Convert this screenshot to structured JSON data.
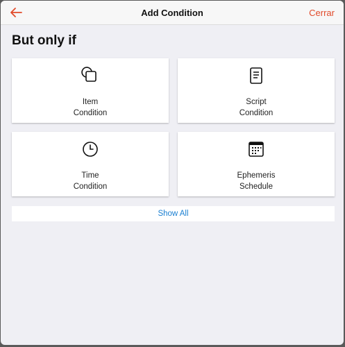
{
  "navbar": {
    "title": "Add Condition",
    "cancel_label": "Cerrar",
    "accent_color": "#e14a2a"
  },
  "section": {
    "title": "But only if"
  },
  "cards": [
    {
      "icon": "overlapping-squares-icon",
      "line1": "Item",
      "line2": "Condition"
    },
    {
      "icon": "document-icon",
      "line1": "Script",
      "line2": "Condition"
    },
    {
      "icon": "clock-icon",
      "line1": "Time",
      "line2": "Condition"
    },
    {
      "icon": "calendar-icon",
      "line1": "Ephemeris",
      "line2": "Schedule"
    }
  ],
  "show_all": {
    "label": "Show All",
    "color": "#1a7fd1"
  }
}
